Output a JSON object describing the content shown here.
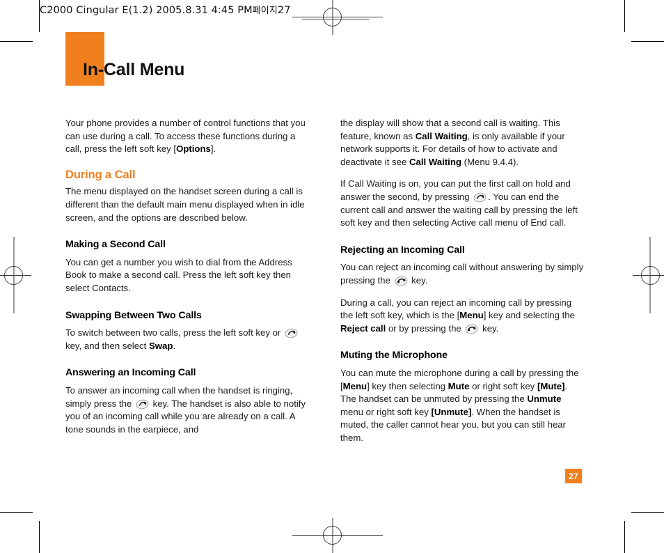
{
  "print_marks": {
    "slug_line": "C2000 Cingular  E(1.2)  2005.8.31 4:45 PM",
    "slug_korean": "페이지",
    "slug_page": "27"
  },
  "title": {
    "text": "In-Call Menu",
    "accent_color": "#f0801e"
  },
  "page_number": "27",
  "icons": {
    "send_key": "phone-send-key-icon",
    "end_key": "phone-end-key-icon"
  },
  "left_column": {
    "intro": {
      "p1_a": "Your phone provides a number of control functions that you can use during a call. To access these functions during a call, press the left soft key [",
      "p1_b": "Options",
      "p1_c": "]."
    },
    "during_a_call": {
      "heading": "During a Call",
      "p1": "The menu displayed on the handset screen during a call is different than the default main menu displayed when in idle screen, and the options are described below."
    },
    "making_second_call": {
      "heading": "Making a Second Call",
      "p1": "You can get a number you wish to dial from the Address Book to make a second call. Press the left soft key then select Contacts."
    },
    "swapping": {
      "heading": "Swapping Between Two Calls",
      "p1_a": "To switch between two calls, press the left soft key or",
      "p1_b": "key, and then select",
      "p1_c": "Swap",
      "p1_d": "."
    },
    "answering": {
      "heading": "Answering an Incoming Call",
      "p1_a": "To answer an incoming call when the handset is ringing, simply press the",
      "p1_b": "key. The handset is also able to notify you of an incoming call while you are already on a call. A tone sounds in the earpiece, and"
    }
  },
  "right_column": {
    "continued": {
      "p1_a": "the display will show that a second call is waiting. This feature, known as ",
      "p1_b": "Call Waiting",
      "p1_c": ", is only available if your network supports it. For details of how to activate and deactivate it see ",
      "p1_d": "Call Waiting",
      "p1_e": " (Menu 9.4.4).",
      "p2_a": "If Call Waiting is on, you can put the first call on hold and answer the second, by pressing",
      "p2_b": ". You can end the current call and answer the waiting call by pressing the left soft key and then selecting Active call menu of End call."
    },
    "rejecting": {
      "heading": "Rejecting an Incoming Call",
      "p1_a": "You can reject an incoming call without answering by simply pressing the",
      "p1_b": "key.",
      "p2_a": "During a call, you can reject an incoming call by pressing the left soft key, which is the [",
      "p2_b": "Menu",
      "p2_c": "] key and selecting the ",
      "p2_d": "Reject call",
      "p2_e": " or by pressing the",
      "p2_f": "key."
    },
    "muting": {
      "heading": "Muting the Microphone",
      "p1_a": "You can mute the microphone during a call by pressing the [",
      "p1_b": "Menu",
      "p1_c": "] key then selecting ",
      "p1_d": "Mute",
      "p1_e": " or right soft key ",
      "p1_f": "[Mute]",
      "p1_g": ". The handset can be unmuted by pressing the ",
      "p1_h": "Unmute",
      "p1_i": " menu or right soft key ",
      "p1_j": "[Unmute]",
      "p1_k": ". When the handset is muted, the caller cannot hear you, but you can still hear them."
    }
  }
}
